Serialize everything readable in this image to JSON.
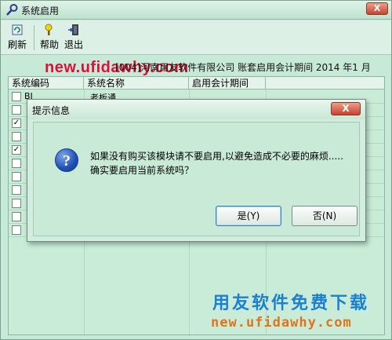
{
  "window": {
    "title": "系统启用",
    "close": "X"
  },
  "toolbar": {
    "refresh": "刷新",
    "help": "帮助",
    "exit": "退出"
  },
  "watermark_top": "new.ufidawhy.com",
  "account_info": "[004]河南用友软件有限公司 账套启用会计期间 2014 年1 月",
  "grid": {
    "headers": [
      "系统编码",
      "系统名称",
      "启用会计期间"
    ],
    "rows": [
      {
        "code": "BI",
        "name": "老板通",
        "checked": false
      },
      {
        "code": "",
        "name": "",
        "checked": false
      },
      {
        "code": "",
        "name": "",
        "checked": true
      },
      {
        "code": "",
        "name": "",
        "checked": false
      },
      {
        "code": "",
        "name": "",
        "checked": true
      },
      {
        "code": "",
        "name": "",
        "checked": false
      },
      {
        "code": "",
        "name": "",
        "checked": false
      },
      {
        "code": "",
        "name": "",
        "checked": false
      },
      {
        "code": "",
        "name": "",
        "checked": false
      },
      {
        "code": "",
        "name": "",
        "checked": false
      },
      {
        "code": "",
        "name": "",
        "checked": false
      }
    ]
  },
  "dialog": {
    "title": "提示信息",
    "close": "X",
    "message_line1": "如果没有购买该模块请不要启用,以避免造成不必要的麻烦.....",
    "message_line2": "确实要启用当前系统吗？",
    "yes_label": "是(Y)",
    "no_label": "否(N)"
  },
  "watermark_bottom": {
    "cn": "用友软件免费下载",
    "url": "new.ufidawhy.com"
  }
}
